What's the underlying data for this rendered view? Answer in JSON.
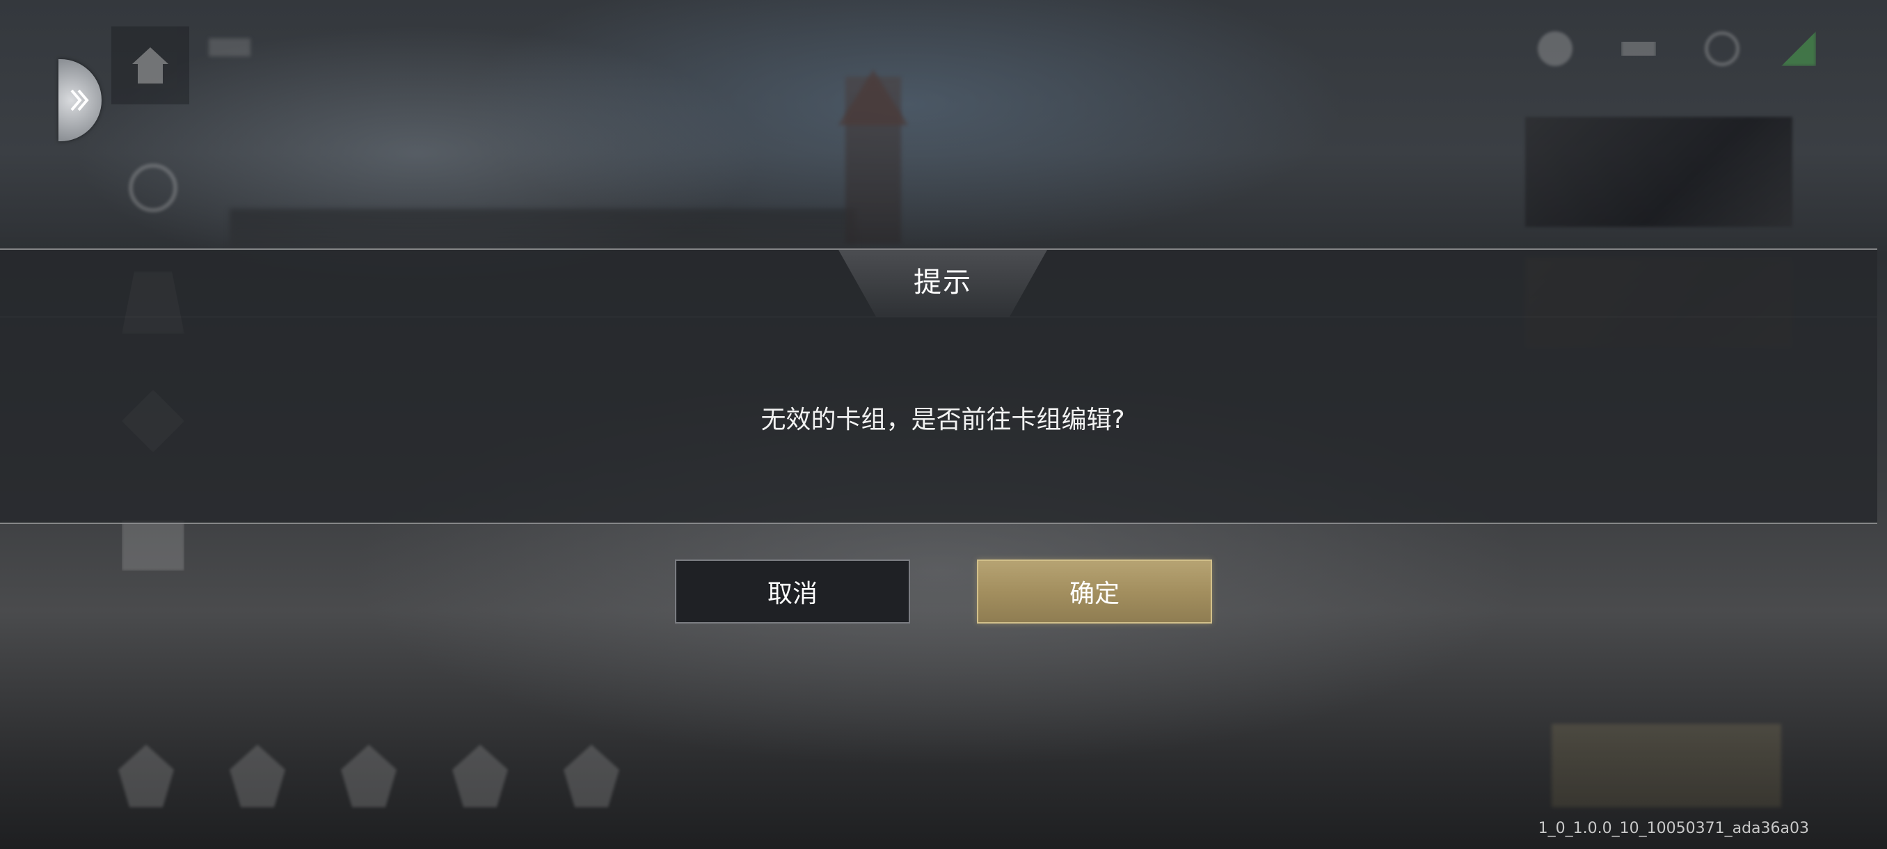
{
  "dialog": {
    "title": "提示",
    "message": "无效的卡组，是否前往卡组编辑?",
    "cancel_label": "取消",
    "confirm_label": "确定"
  },
  "footer": {
    "version": "1_0_1.0.0_10_10050371_ada36a03"
  },
  "colors": {
    "confirm_gold": "#a38f5f",
    "cancel_dark": "#1f2125",
    "dialog_band": "#26282c"
  },
  "icons": {
    "expand": "double-chevron-right-icon",
    "home": "home-icon"
  }
}
